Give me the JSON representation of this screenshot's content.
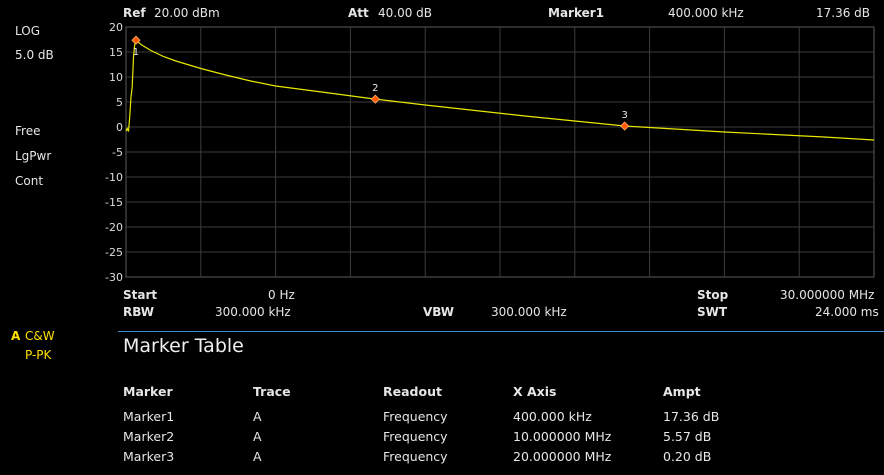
{
  "top": {
    "ref_label": "Ref",
    "ref_value": "20.00 dBm",
    "att_label": "Att",
    "att_value": "40.00 dB",
    "marker_label": "Marker1",
    "marker_freq": "400.000 kHz",
    "marker_ampl": "17.36 dB"
  },
  "left": {
    "scale_type": "LOG",
    "scale_div": "5.0 dB",
    "trigger": "Free",
    "detector": "LgPwr",
    "sweep_mode": "Cont",
    "trace_letter": "A",
    "trace_type": "C&W",
    "trace_detector": "P-PK"
  },
  "bottom": {
    "start_label": "Start",
    "start_value": "0 Hz",
    "stop_label": "Stop",
    "stop_value": "30.000000 MHz",
    "rbw_label": "RBW",
    "rbw_value": "300.000 kHz",
    "vbw_label": "VBW",
    "vbw_value": "300.000 kHz",
    "swt_label": "SWT",
    "swt_value": "24.000 ms"
  },
  "chart_data": {
    "type": "line",
    "ylim": [
      -30,
      20
    ],
    "xlim": [
      0,
      30
    ],
    "x_unit": "MHz",
    "y_ticks": [
      "20",
      "15",
      "10",
      "5",
      "0",
      "-5",
      "-10",
      "-15",
      "-20",
      "-25",
      "-30"
    ],
    "grid": true,
    "trace_color": "#e8e800",
    "marker_color": "#ff5a00",
    "series": [
      {
        "x": [
          0,
          0.05,
          0.1,
          0.15,
          0.2,
          0.25,
          0.3,
          0.35,
          0.4,
          0.6,
          1,
          1.5,
          2,
          3,
          4,
          5,
          6,
          8,
          10,
          12,
          14,
          16,
          18,
          20,
          22,
          24,
          26,
          28,
          30
        ],
        "y": [
          -0.8,
          -0.3,
          -0.9,
          2,
          6,
          8,
          14,
          16.5,
          17.36,
          16.5,
          15.3,
          14.1,
          13.2,
          11.7,
          10.4,
          9.2,
          8.2,
          6.9,
          5.57,
          4.4,
          3.3,
          2.2,
          1.2,
          0.2,
          -0.4,
          -1.0,
          -1.5,
          -2.0,
          -2.6
        ]
      }
    ],
    "markers": [
      {
        "label": "1",
        "x": 0.4,
        "y": 17.36
      },
      {
        "label": "2",
        "x": 10,
        "y": 5.57
      },
      {
        "label": "3",
        "x": 20,
        "y": 0.2
      }
    ]
  },
  "marker_table": {
    "title": "Marker Table",
    "headers": [
      "Marker",
      "Trace",
      "Readout",
      "X Axis",
      "Ampt"
    ],
    "rows": [
      [
        "Marker1",
        "A",
        "Frequency",
        "400.000 kHz",
        "17.36 dB"
      ],
      [
        "Marker2",
        "A",
        "Frequency",
        "10.000000 MHz",
        "5.57 dB"
      ],
      [
        "Marker3",
        "A",
        "Frequency",
        "20.000000 MHz",
        "0.20 dB"
      ]
    ]
  }
}
